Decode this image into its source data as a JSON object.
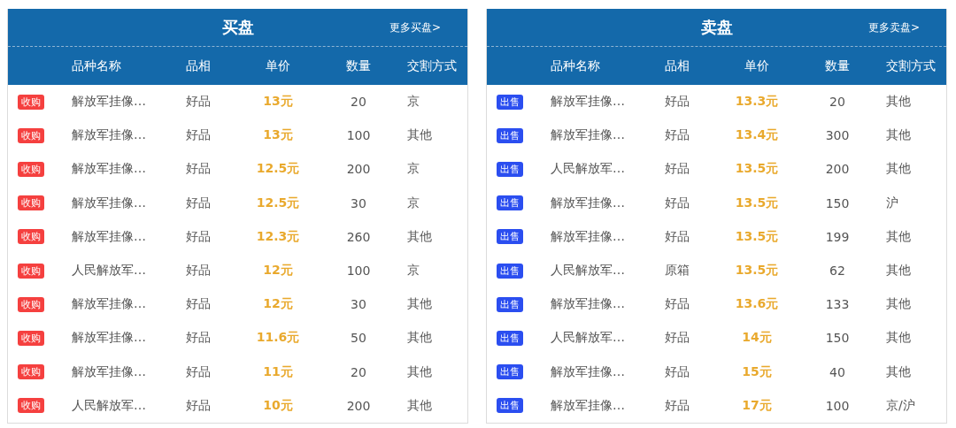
{
  "panels": [
    {
      "title": "买盘",
      "more_link": "更多买盘>",
      "color": "#f5403f",
      "columns": [
        "品种名称",
        "品相",
        "单价",
        "数量",
        "交割方式"
      ],
      "rows": [
        {
          "badge": "收购",
          "name": "解放军挂像…",
          "grade": "好品",
          "price": "13元",
          "quantity": "20",
          "delivery": "京"
        },
        {
          "badge": "收购",
          "name": "解放军挂像…",
          "grade": "好品",
          "price": "13元",
          "quantity": "100",
          "delivery": "其他"
        },
        {
          "badge": "收购",
          "name": "解放军挂像…",
          "grade": "好品",
          "price": "12.5元",
          "quantity": "200",
          "delivery": "京"
        },
        {
          "badge": "收购",
          "name": "解放军挂像…",
          "grade": "好品",
          "price": "12.5元",
          "quantity": "30",
          "delivery": "京"
        },
        {
          "badge": "收购",
          "name": "解放军挂像…",
          "grade": "好品",
          "price": "12.3元",
          "quantity": "260",
          "delivery": "其他"
        },
        {
          "badge": "收购",
          "name": "人民解放军…",
          "grade": "好品",
          "price": "12元",
          "quantity": "100",
          "delivery": "京"
        },
        {
          "badge": "收购",
          "name": "解放军挂像…",
          "grade": "好品",
          "price": "12元",
          "quantity": "30",
          "delivery": "其他"
        },
        {
          "badge": "收购",
          "name": "解放军挂像…",
          "grade": "好品",
          "price": "11.6元",
          "quantity": "50",
          "delivery": "其他"
        },
        {
          "badge": "收购",
          "name": "解放军挂像…",
          "grade": "好品",
          "price": "11元",
          "quantity": "20",
          "delivery": "其他"
        },
        {
          "badge": "收购",
          "name": "人民解放军…",
          "grade": "好品",
          "price": "10元",
          "quantity": "200",
          "delivery": "其他"
        }
      ]
    },
    {
      "title": "卖盘",
      "more_link": "更多卖盘>",
      "color": "#2b4ef0",
      "columns": [
        "品种名称",
        "品相",
        "单价",
        "数量",
        "交割方式"
      ],
      "rows": [
        {
          "badge": "出售",
          "name": "解放军挂像…",
          "grade": "好品",
          "price": "13.3元",
          "quantity": "20",
          "delivery": "其他"
        },
        {
          "badge": "出售",
          "name": "解放军挂像…",
          "grade": "好品",
          "price": "13.4元",
          "quantity": "300",
          "delivery": "其他"
        },
        {
          "badge": "出售",
          "name": "人民解放军…",
          "grade": "好品",
          "price": "13.5元",
          "quantity": "200",
          "delivery": "其他"
        },
        {
          "badge": "出售",
          "name": "解放军挂像…",
          "grade": "好品",
          "price": "13.5元",
          "quantity": "150",
          "delivery": "沪"
        },
        {
          "badge": "出售",
          "name": "解放军挂像…",
          "grade": "好品",
          "price": "13.5元",
          "quantity": "199",
          "delivery": "其他"
        },
        {
          "badge": "出售",
          "name": "人民解放军…",
          "grade": "原箱",
          "price": "13.5元",
          "quantity": "62",
          "delivery": "其他"
        },
        {
          "badge": "出售",
          "name": "解放军挂像…",
          "grade": "好品",
          "price": "13.6元",
          "quantity": "133",
          "delivery": "其他"
        },
        {
          "badge": "出售",
          "name": "人民解放军…",
          "grade": "好品",
          "price": "14元",
          "quantity": "150",
          "delivery": "其他"
        },
        {
          "badge": "出售",
          "name": "解放军挂像…",
          "grade": "好品",
          "price": "15元",
          "quantity": "40",
          "delivery": "其他"
        },
        {
          "badge": "出售",
          "name": "解放军挂像…",
          "grade": "好品",
          "price": "17元",
          "quantity": "100",
          "delivery": "京/沪"
        }
      ]
    }
  ]
}
